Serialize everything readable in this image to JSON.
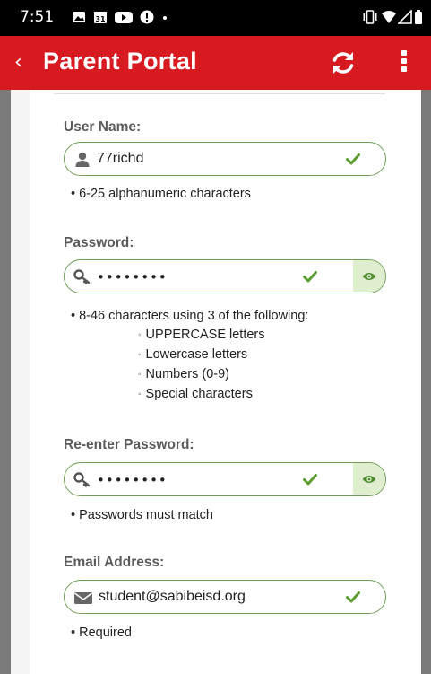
{
  "status_bar": {
    "time": "7:51",
    "icons_left": [
      "image-icon",
      "calendar-icon",
      "youtube-icon",
      "alert-icon"
    ],
    "icons_right": [
      "vibrate-icon",
      "wifi-icon",
      "signal-icon",
      "battery-icon"
    ]
  },
  "app_bar": {
    "back_glyph": "‹",
    "title": "Parent Portal",
    "color": "#d71920"
  },
  "form": {
    "user_name": {
      "label": "User Name:",
      "value": "77richd",
      "hints": [
        "• 6-25 alphanumeric characters"
      ]
    },
    "password": {
      "label": "Password:",
      "value": "••••••••",
      "hints": [
        "• 8-46 characters using 3 of the following:"
      ],
      "sub_hints": [
        "UPPERCASE letters",
        "Lowercase letters",
        "Numbers (0-9)",
        "Special characters"
      ]
    },
    "reenter_password": {
      "label": "Re-enter Password:",
      "value": "••••••••",
      "hints": [
        "• Passwords must match"
      ]
    },
    "email": {
      "label": "Email Address:",
      "value": "student@sabibeisd.org",
      "hints": [
        "• Required"
      ]
    }
  },
  "colors": {
    "valid_border": "#6f9f55",
    "check": "#5a9e2f",
    "eye_bg": "#dfeecf"
  }
}
